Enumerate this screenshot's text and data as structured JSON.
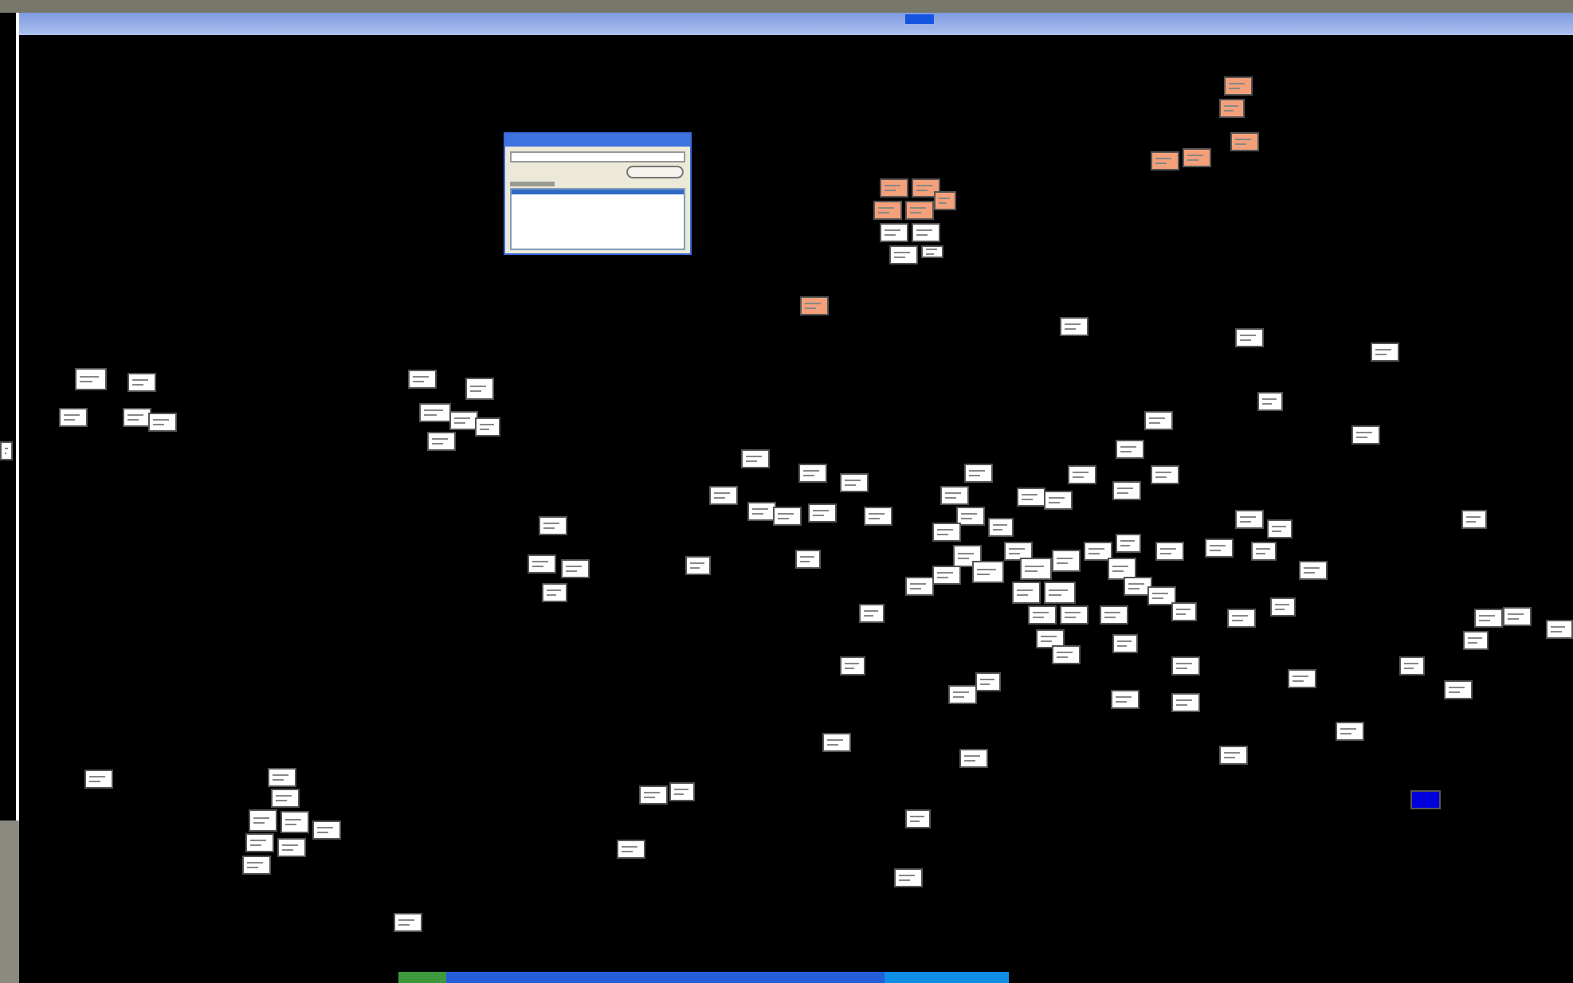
{
  "graph": {
    "nodes": [
      {
        "color": "#ffffff"
      },
      {
        "color": "#ffffff"
      },
      {
        "color": "#ffffff"
      },
      {
        "color": "#ffffff"
      },
      {
        "color": "#ffffff"
      },
      {
        "color": "#ffffff"
      },
      {
        "color": "#ffffff"
      },
      {
        "color": "#ffffff"
      },
      {
        "color": "#ffffff"
      },
      {
        "color": "#ffffff"
      },
      {
        "color": "#ffffff"
      },
      {
        "color": "#ffffff"
      },
      {
        "color": "#ffffff"
      },
      {
        "color": "#ffffff"
      },
      {
        "color": "#ffffff"
      },
      {
        "color": "#ffffff"
      },
      {
        "color": "#ffffff"
      },
      {
        "color": "#ffffff"
      },
      {
        "color": "#ffffff"
      },
      {
        "color": "#ffffff"
      },
      {
        "color": "#ffffff"
      },
      {
        "color": "#ffffff"
      },
      {
        "color": "#ffffff"
      },
      {
        "color": "#ffffff"
      },
      {
        "color": "#ffffff"
      },
      {
        "color": "#ffffff"
      },
      {
        "color": "#ffffff"
      },
      {
        "color": "#ffffff"
      },
      {
        "color": "#ffffff"
      },
      {
        "color": "#ffffff"
      },
      {
        "color": "#ffffff"
      },
      {
        "color": "#ffffff"
      },
      {
        "color": "#ffffff"
      },
      {
        "color": "#ffffff"
      },
      {
        "color": "#ffffff"
      },
      {
        "color": "#ffffff"
      },
      {
        "color": "#ffffff"
      },
      {
        "color": "#ffffff"
      },
      {
        "color": "#ffffff"
      },
      {
        "color": "#ffffff"
      },
      {
        "color": "#ffffff"
      },
      {
        "color": "#ffffff"
      },
      {
        "color": "#ffffff"
      },
      {
        "color": "#ffffff"
      },
      {
        "color": "#ffffff"
      },
      {
        "color": "#ffffff"
      },
      {
        "color": "#ffffff"
      },
      {
        "color": "#ffffff"
      },
      {
        "color": "#ffffff"
      },
      {
        "color": "#ffffff"
      },
      {
        "color": "#ffffff"
      },
      {
        "color": "#ffffff"
      },
      {
        "color": "#ffffff"
      },
      {
        "color": "#ffffff"
      },
      {
        "color": "#ffffff"
      },
      {
        "color": "#ffffff"
      },
      {
        "color": "#ffffff"
      },
      {
        "color": "#ffffff"
      },
      {
        "color": "#ffffff"
      },
      {
        "color": "#ffffff"
      },
      {
        "color": "#ffffff"
      },
      {
        "color": "#ffffff"
      },
      {
        "color": "#ffffff"
      },
      {
        "color": "#ffffff"
      },
      {
        "color": "#ffffff"
      },
      {
        "color": "#ffffff"
      },
      {
        "color": "#ffffff"
      },
      {
        "color": "#ffffff"
      },
      {
        "color": "#ffffff"
      },
      {
        "color": "#ffffff"
      },
      {
        "color": "#ffffff"
      },
      {
        "color": "#ffffff"
      },
      {
        "color": "#ffffff"
      },
      {
        "color": "#ffffff"
      },
      {
        "color": "#ffffff"
      },
      {
        "color": "#ffffff"
      },
      {
        "color": "#ffffff"
      },
      {
        "color": "#ffffff"
      },
      {
        "color": "#ffffff"
      },
      {
        "color": "#ffffff"
      },
      {
        "color": "#ffffff"
      },
      {
        "color": "#ffffff"
      },
      {
        "color": "#ffffff"
      },
      {
        "color": "#ffffff"
      },
      {
        "color": "#ffffff"
      },
      {
        "color": "#ffffff"
      },
      {
        "color": "#ffffff"
      },
      {
        "color": "#ffffff"
      },
      {
        "color": "#ffffff"
      },
      {
        "color": "#ffffff"
      },
      {
        "color": "#ffffff"
      },
      {
        "color": "#ffffff"
      },
      {
        "color": "#ffffff"
      },
      {
        "color": "#ffffff"
      },
      {
        "color": "#ffffff"
      },
      {
        "color": "#ffffff"
      },
      {
        "color": "#ffffff"
      },
      {
        "color": "#ffffff"
      },
      {
        "color": "#ffffff"
      },
      {
        "color": "#ffffff"
      },
      {
        "color": "#ffffff"
      },
      {
        "color": "#ffffff"
      },
      {
        "color": "#ffffff"
      },
      {
        "color": "#ffffff"
      },
      {
        "color": "#ffffff"
      },
      {
        "color": "#ffffff"
      },
      {
        "color": "#ffffff"
      },
      {
        "color": "#ffffff"
      },
      {
        "color": "#ffffff"
      },
      {
        "color": "#ffffff"
      },
      {
        "color": "#f4a07a"
      },
      {
        "color": "#f4a07a"
      },
      {
        "color": "#f4a07a"
      },
      {
        "color": "#f4a07a"
      },
      {
        "color": "#f4a07a"
      },
      {
        "color": "#f4a07a"
      },
      {
        "color": "#f4a07a"
      },
      {
        "color": "#f4a07a"
      },
      {
        "color": "#f4a07a"
      },
      {
        "color": "#f4a07a"
      },
      {
        "color": "#f4a07a"
      },
      {
        "color": "#0000dd",
        "kind": "marker"
      }
    ]
  },
  "dialog": {
    "items": [
      {
        "selected": true
      }
    ]
  }
}
